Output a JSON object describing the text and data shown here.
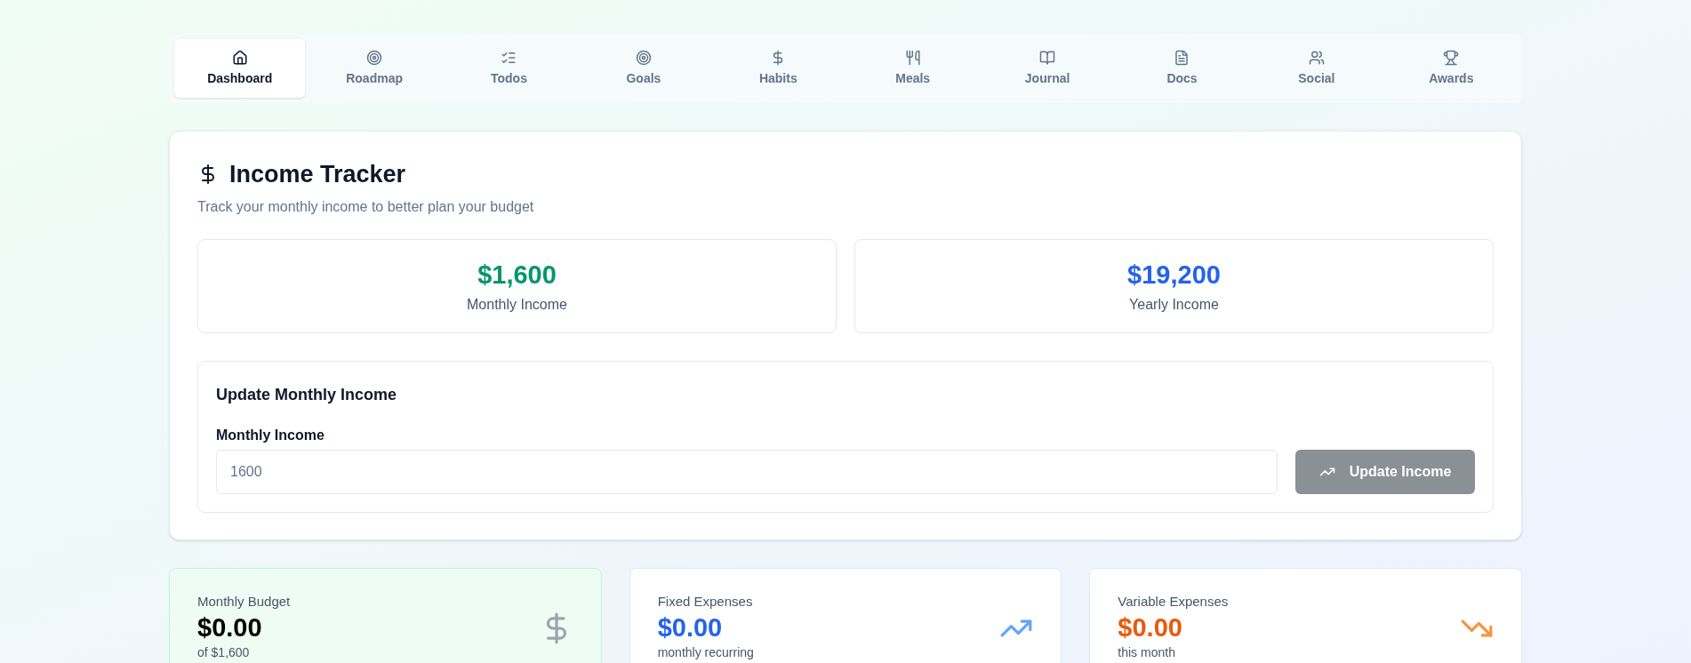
{
  "nav": [
    {
      "label": "Dashboard",
      "selected": true
    },
    {
      "label": "Roadmap",
      "selected": false
    },
    {
      "label": "Todos",
      "selected": false
    },
    {
      "label": "Goals",
      "selected": false
    },
    {
      "label": "Habits",
      "selected": false
    },
    {
      "label": "Meals",
      "selected": false
    },
    {
      "label": "Journal",
      "selected": false
    },
    {
      "label": "Docs",
      "selected": false
    },
    {
      "label": "Social",
      "selected": false
    },
    {
      "label": "Awards",
      "selected": false
    }
  ],
  "income_tracker": {
    "title": "Income Tracker",
    "subtitle": "Track your monthly income to better plan your budget",
    "stats": [
      {
        "value": "$1,600",
        "label": "Monthly Income",
        "color": "#059669"
      },
      {
        "value": "$19,200",
        "label": "Yearly Income",
        "color": "#2563eb"
      }
    ],
    "update": {
      "title": "Update Monthly Income",
      "field_label": "Monthly Income",
      "placeholder": "1600",
      "button": {
        "label": "Update Income",
        "disabled": true
      }
    }
  },
  "summary_cards": [
    {
      "title": "Monthly Budget",
      "value": "$0.00",
      "note": "of $1,600",
      "color": "#000000",
      "kind": "budget"
    },
    {
      "title": "Fixed Expenses",
      "value": "$0.00",
      "note": "monthly recurring",
      "color": "#2563eb",
      "kind": "plain"
    },
    {
      "title": "Variable Expenses",
      "value": "$0.00",
      "note": "this month",
      "color": "#ea580c",
      "kind": "plain"
    }
  ]
}
